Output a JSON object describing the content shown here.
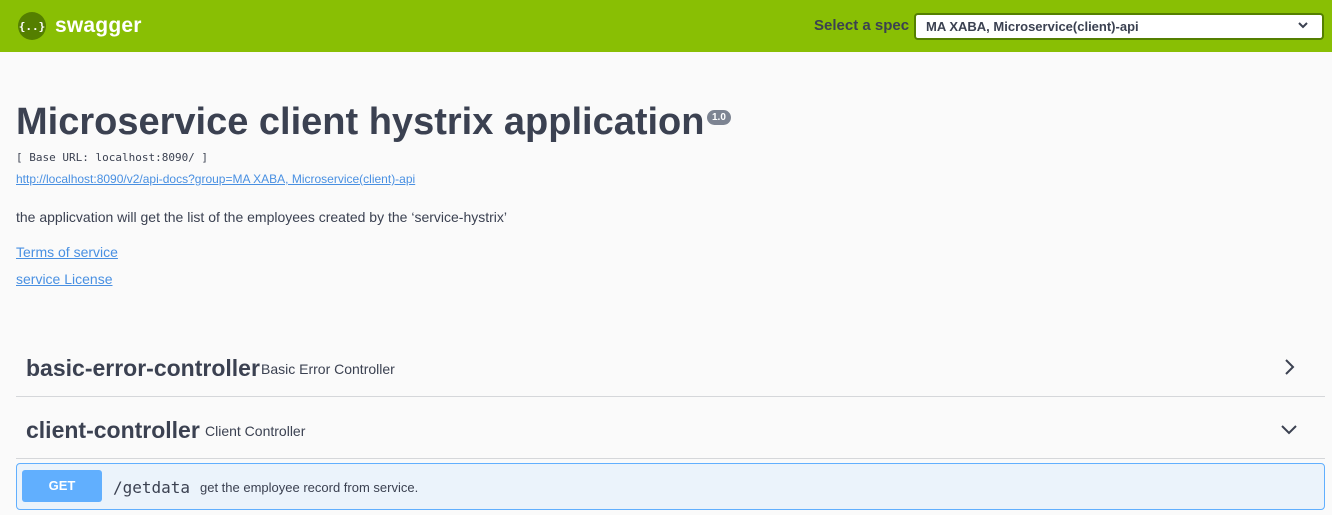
{
  "topbar": {
    "logo_badge": "{..}",
    "logo_text": "swagger",
    "spec_label": "Select a spec",
    "spec_selected": "MA XABA, Microservice(client)-api"
  },
  "info": {
    "title": "Microservice client hystrix application",
    "version": "1.0",
    "base_url": "[ Base URL: localhost:8090/ ]",
    "docs_link": "http://localhost:8090/v2/api-docs?group=MA XABA, Microservice(client)-api",
    "description": "the applicvation will get the list of the employees created by the ‘service-hystrix’",
    "terms_link": "Terms of service",
    "license_link": "service License"
  },
  "tags": [
    {
      "name": "basic-error-controller",
      "description": "Basic Error Controller",
      "expanded": false
    },
    {
      "name": "client-controller",
      "description": "Client Controller",
      "expanded": true
    }
  ],
  "operations": [
    {
      "method": "GET",
      "path": "/getdata",
      "summary": "get the employee record from service."
    }
  ],
  "colors": {
    "topbar": "#89bf04",
    "get_method": "#61affe",
    "link": "#4990e2",
    "text": "#3b4151"
  }
}
